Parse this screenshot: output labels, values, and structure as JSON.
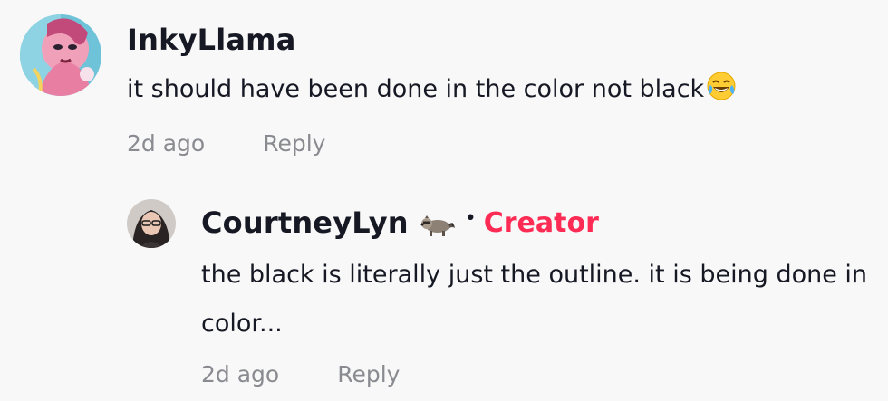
{
  "comment": {
    "username": "InkyLlama",
    "avatar_icon": "avatar-artwork-icon",
    "text": "it should have been done in the color not black",
    "emoji_icon": "laughing-tears-emoji-icon",
    "time": "2d ago",
    "reply_label": "Reply"
  },
  "reply": {
    "username": "CourtneyLyn",
    "avatar_icon": "avatar-photo-icon",
    "badge_icon": "raccoon-emoji-icon",
    "separator": "•",
    "creator_label": "Creator",
    "text": "the black is literally just the outline. it is being done in color...",
    "time": "2d ago",
    "reply_label": "Reply"
  },
  "colors": {
    "background": "#f8f8f8",
    "text": "#161823",
    "muted": "#8a8b91",
    "creator": "#fe2c55"
  }
}
